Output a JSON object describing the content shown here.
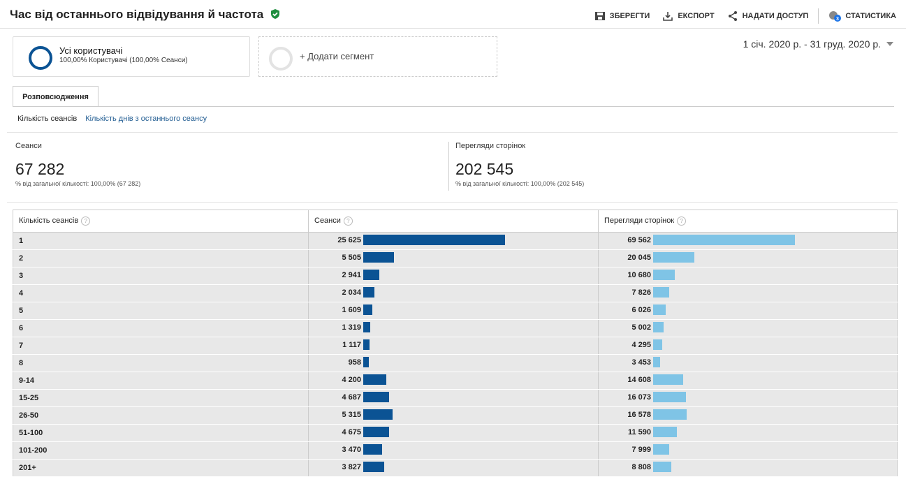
{
  "title": "Час від останнього відвідування й частота",
  "actions": {
    "save": "ЗБЕРЕГТИ",
    "export": "ЕКСПОРТ",
    "share": "НАДАТИ ДОСТУП",
    "insights": "СТАТИСТИКА",
    "insights_badge": "3"
  },
  "segment": {
    "name": "Усі користувачі",
    "subtitle": "100,00% Користувачі (100,00% Сеанси)",
    "add_label": "+ Додати сегмент"
  },
  "date_range": "1 січ. 2020 р. - 31 груд. 2020 р.",
  "tab": "Розповсюдження",
  "subtabs": [
    "Кількість сеансів",
    "Кількість днів з останнього сеансу"
  ],
  "metrics": [
    {
      "label": "Сеанси",
      "value": "67 282",
      "pct": "% від загальної кількості: 100,00% (67 282)"
    },
    {
      "label": "Перегляди сторінок",
      "value": "202 545",
      "pct": "% від загальної кількості: 100,00% (202 545)"
    }
  ],
  "table": {
    "headers": [
      "Кількість сеансів",
      "Сеанси",
      "Перегляди сторінок"
    ],
    "rows": [
      {
        "label": "1",
        "sessions": "25 625",
        "pageviews": "69 562",
        "s_frac": 1.0,
        "p_frac": 1.0
      },
      {
        "label": "2",
        "sessions": "5 505",
        "pageviews": "20 045",
        "s_frac": 0.2148,
        "p_frac": 0.2882
      },
      {
        "label": "3",
        "sessions": "2 941",
        "pageviews": "10 680",
        "s_frac": 0.1148,
        "p_frac": 0.1535
      },
      {
        "label": "4",
        "sessions": "2 034",
        "pageviews": "7 826",
        "s_frac": 0.0794,
        "p_frac": 0.1125
      },
      {
        "label": "5",
        "sessions": "1 609",
        "pageviews": "6 026",
        "s_frac": 0.0628,
        "p_frac": 0.0866
      },
      {
        "label": "6",
        "sessions": "1 319",
        "pageviews": "5 002",
        "s_frac": 0.0515,
        "p_frac": 0.0719
      },
      {
        "label": "7",
        "sessions": "1 117",
        "pageviews": "4 295",
        "s_frac": 0.0436,
        "p_frac": 0.0617
      },
      {
        "label": "8",
        "sessions": "958",
        "pageviews": "3 453",
        "s_frac": 0.0374,
        "p_frac": 0.0496
      },
      {
        "label": "9-14",
        "sessions": "4 200",
        "pageviews": "14 608",
        "s_frac": 0.1639,
        "p_frac": 0.21
      },
      {
        "label": "15-25",
        "sessions": "4 687",
        "pageviews": "16 073",
        "s_frac": 0.1829,
        "p_frac": 0.2311
      },
      {
        "label": "26-50",
        "sessions": "5 315",
        "pageviews": "16 578",
        "s_frac": 0.2074,
        "p_frac": 0.2383
      },
      {
        "label": "51-100",
        "sessions": "4 675",
        "pageviews": "11 590",
        "s_frac": 0.1824,
        "p_frac": 0.1666
      },
      {
        "label": "101-200",
        "sessions": "3 470",
        "pageviews": "7 999",
        "s_frac": 0.1354,
        "p_frac": 0.115
      },
      {
        "label": "201+",
        "sessions": "3 827",
        "pageviews": "8 808",
        "s_frac": 0.1493,
        "p_frac": 0.1266
      }
    ]
  },
  "colors": {
    "sessions_bar": "#0b5394",
    "pageviews_bar": "#7fc4e6",
    "verified": "#1e8e3e"
  }
}
